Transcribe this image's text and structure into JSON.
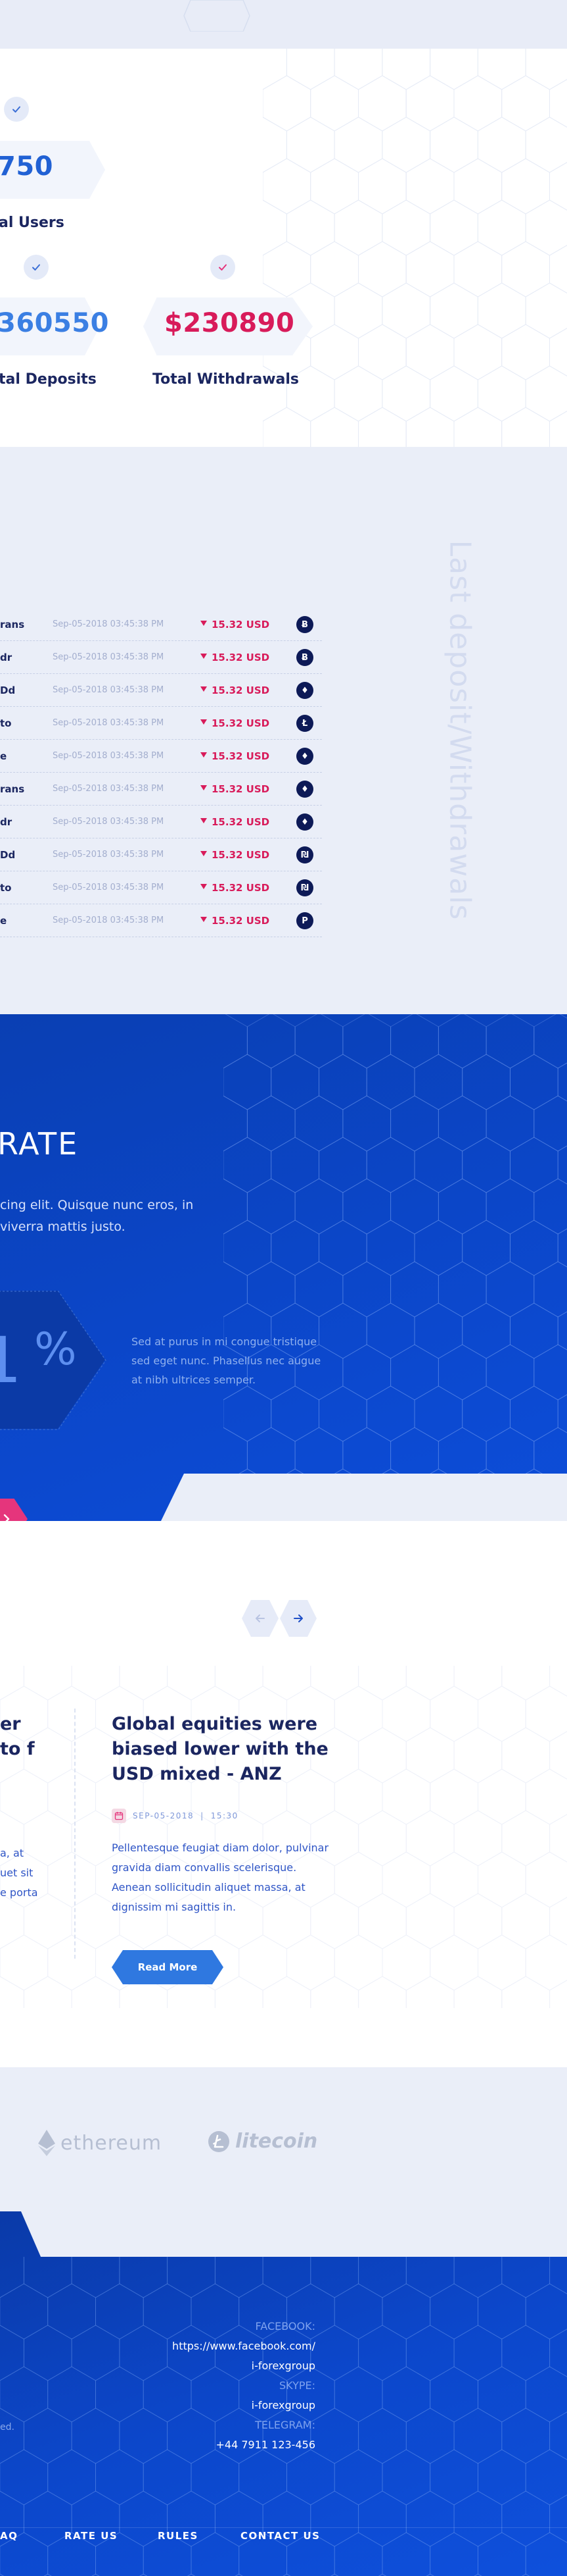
{
  "stats": {
    "items": [
      {
        "value": "750",
        "label": "al Users",
        "color": "#2161d4"
      },
      {
        "value": "360550",
        "label": "tal Deposits",
        "color": "#3b7fe3"
      },
      {
        "value": "$230890",
        "label": "Total Withdrawals",
        "color": "#d81b5a"
      }
    ],
    "check_color_blue": "#3b6fd6",
    "check_color_pink": "#e5357c"
  },
  "transactions": {
    "vertical_title": "Last deposit/Withdrawals",
    "rows": [
      {
        "name": "rans",
        "date": "Sep-05-2018 03:45:38 PM",
        "amount": "15.32 USD",
        "icon": "bitcoin-icon",
        "glyph": "Ƀ"
      },
      {
        "name": "dr",
        "date": "Sep-05-2018 03:45:38 PM",
        "amount": "15.32 USD",
        "icon": "bitcoin-icon",
        "glyph": "Ƀ"
      },
      {
        "name": "Dd",
        "date": "Sep-05-2018 03:45:38 PM",
        "amount": "15.32 USD",
        "icon": "ethereum-icon",
        "glyph": "♦"
      },
      {
        "name": "to",
        "date": "Sep-05-2018 03:45:38 PM",
        "amount": "15.32 USD",
        "icon": "litecoin-icon",
        "glyph": "Ł"
      },
      {
        "name": "e",
        "date": "Sep-05-2018 03:45:38 PM",
        "amount": "15.32 USD",
        "icon": "ethereum-icon",
        "glyph": "♦"
      },
      {
        "name": "rans",
        "date": "Sep-05-2018 03:45:38 PM",
        "amount": "15.32 USD",
        "icon": "ethereum-icon",
        "glyph": "♦"
      },
      {
        "name": "dr",
        "date": "Sep-05-2018 03:45:38 PM",
        "amount": "15.32 USD",
        "icon": "ethereum-icon",
        "glyph": "♦"
      },
      {
        "name": "Dd",
        "date": "Sep-05-2018 03:45:38 PM",
        "amount": "15.32 USD",
        "icon": "coin-icon",
        "glyph": "₪"
      },
      {
        "name": "to",
        "date": "Sep-05-2018 03:45:38 PM",
        "amount": "15.32 USD",
        "icon": "coin-icon",
        "glyph": "₪"
      },
      {
        "name": "e",
        "date": "Sep-05-2018 03:45:38 PM",
        "amount": "15.32 USD",
        "icon": "p-coin-icon",
        "glyph": "P"
      }
    ]
  },
  "rate": {
    "title": "RATE",
    "description": "cing elit. Quisque nunc eros, in viverra mattis justo.",
    "percent": "1",
    "percent_sign": "%",
    "side_text": "Sed at purus in mi congue tristique sed eget nunc. Phasellus nec augue at nibh ultrices semper."
  },
  "news": {
    "items": [
      {
        "title": "er to f",
        "text": "a, at uet sit e porta"
      },
      {
        "title": "Global equities were biased lower with the USD mixed - ANZ",
        "date": "SEP-05-2018",
        "time": "15:30",
        "text": "Pellentesque feugiat diam dolor, pulvinar gravida diam convallis scelerisque. Aenean sollicitudin aliquet massa, at dignissim mi sagittis in.",
        "button": "Read More"
      }
    ]
  },
  "partners": {
    "items": [
      {
        "name": "ethereum",
        "icon": "ethereum-logo-icon"
      },
      {
        "name": "litecoin",
        "icon": "litecoin-logo-icon"
      }
    ]
  },
  "footer": {
    "contacts": [
      {
        "label": "FACEBOOK:",
        "lines": [
          "https://www.facebook.com/",
          "i-forexgroup"
        ]
      },
      {
        "label": "SKYPE:",
        "lines": [
          "i-forexgroup"
        ]
      },
      {
        "label": "TELEGRAM:",
        "lines": [
          "+44 7911 123-456"
        ]
      }
    ],
    "copyright": "ed.",
    "links": [
      "AQ",
      "RATE US",
      "RULES",
      "CONTACT US"
    ]
  }
}
